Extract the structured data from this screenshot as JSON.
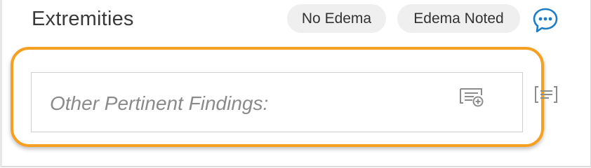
{
  "section": {
    "title": "Extremities"
  },
  "options": [
    {
      "label": "No Edema"
    },
    {
      "label": "Edema Noted"
    }
  ],
  "findings": {
    "placeholder": "Other Pertinent Findings:",
    "value": ""
  },
  "icons": {
    "comment": "comment-bubble-icon",
    "add_template": "add-template-icon",
    "template": "template-icon"
  },
  "colors": {
    "accent": "#1c7fc4",
    "highlight": "#f5a021",
    "pill_bg": "#efefef",
    "text": "#3a3a3a",
    "placeholder": "#8a8a8a"
  }
}
